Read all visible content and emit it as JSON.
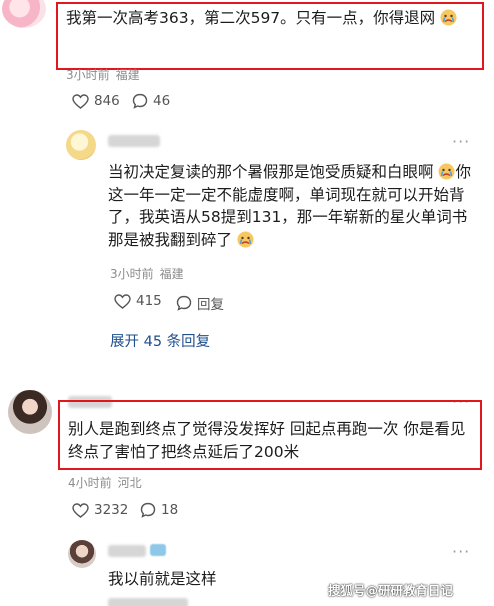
{
  "comments": [
    {
      "text": "我第一次高考363，第二次597。只有一点，你得退网",
      "time": "3小时前",
      "location": "福建",
      "likes": "846",
      "replies": "46"
    },
    {
      "text": "当初决定复读的那个暑假那是饱受质疑和白眼啊",
      "text2": "你这一年一定一定不能虚度啊，单词现在就可以开始背了，我英语从58提到131，那一年崭新的星火单词书那是被我翻到碎了",
      "time": "3小时前",
      "location": "福建",
      "likes": "415",
      "reply_label": "回复",
      "expand_label": "展开 45 条回复"
    },
    {
      "text": "别人是跑到终点了觉得没发挥好 回起点再跑一次 你是看见终点了害怕了把终点延后了200米",
      "time": "4小时前",
      "location": "河北",
      "likes": "3232",
      "replies": "18"
    },
    {
      "text": "我以前就是这样"
    }
  ],
  "more_label": "···",
  "watermark": "搜狐号@研研教育日记",
  "colors": {
    "highlight": "#e0171d",
    "link": "#1f4f8f",
    "meta": "#8c8c8c"
  }
}
